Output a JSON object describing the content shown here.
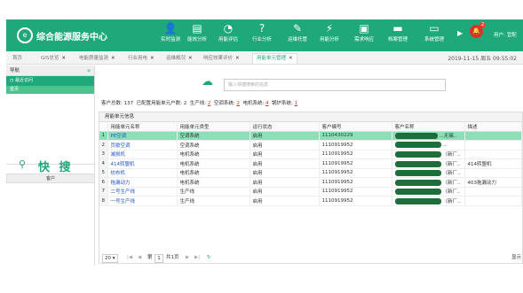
{
  "header": {
    "brand": "综合能源服务中心",
    "nav": [
      {
        "icon": "monitor-person-icon",
        "glyph": "👤",
        "label": "实时监测"
      },
      {
        "icon": "chart-window-icon",
        "glyph": "▤",
        "label": "能效分析"
      },
      {
        "icon": "gauge-icon",
        "glyph": "◔",
        "label": "用能评估"
      },
      {
        "icon": "question-icon",
        "glyph": "?",
        "label": "行业分析"
      },
      {
        "icon": "wrench-icon",
        "glyph": "✎",
        "label": "运维托管"
      },
      {
        "icon": "energy-analysis-icon",
        "glyph": "⚡",
        "label": "用能分析"
      },
      {
        "icon": "demand-response-icon",
        "glyph": "▣",
        "label": "需求响应"
      },
      {
        "icon": "archive-icon",
        "glyph": "▬",
        "label": "档案管理"
      },
      {
        "icon": "system-icon",
        "glyph": "▭",
        "label": "系统管理"
      }
    ],
    "notification_count": "2",
    "user_label": "用户: 宜配"
  },
  "tabs": [
    {
      "label": "首页",
      "closable": false
    },
    {
      "label": "GIS总览",
      "closable": true
    },
    {
      "label": "电能质量监测",
      "closable": true
    },
    {
      "label": "行业用电",
      "closable": true
    },
    {
      "label": "运维概况",
      "closable": true
    },
    {
      "label": "响应效果评价",
      "closable": true
    },
    {
      "label": "用能单元管理",
      "closable": true,
      "active": true
    }
  ],
  "datetime": "2019-11-15 周五 09:55:02",
  "sidebar": {
    "title": "导航",
    "recent_label": "最近访问",
    "selected_item": "首页",
    "quick_search": "快 搜",
    "customer_header": "客户"
  },
  "search": {
    "placeholder": "输入快捷搜索的信息"
  },
  "stats": {
    "total_label": "客户总数:",
    "total_value": "137",
    "configured_label": "已配置用能单元户数:",
    "configured_value": "2",
    "production_label": "生产线:",
    "production_value": "2",
    "aircon_label": "空调系统:",
    "aircon_value": "2",
    "motor_label": "电机系统:",
    "motor_value": "4",
    "boiler_label": "锅炉系统:",
    "boiler_value": "1"
  },
  "table": {
    "title": "用能单元信息",
    "columns": [
      "用能单元名称",
      "用能单元类型",
      "运行状态",
      "客户编号",
      "客户名称",
      "描述"
    ],
    "rows": [
      {
        "n": "1",
        "name": "PE空调",
        "type": "空调系统",
        "status": "启用",
        "cust_no": "1110430229",
        "cust_name": "...无锡..",
        "desc": ""
      },
      {
        "n": "2",
        "name": "页歇空调",
        "type": "空调系统",
        "status": "启用",
        "cust_no": "1110919952",
        "cust_name": "...",
        "desc": ""
      },
      {
        "n": "3",
        "name": "减损机",
        "type": "电机系统",
        "status": "启用",
        "cust_no": "1110919952",
        "cust_name": "（新厂..",
        "desc": ""
      },
      {
        "n": "4",
        "name": "414转盟机",
        "type": "电机系统",
        "status": "启用",
        "cust_no": "1110919952",
        "cust_name": "（新厂..",
        "desc": "414转盟机"
      },
      {
        "n": "5",
        "name": "纺布机",
        "type": "电机系统",
        "status": "启用",
        "cust_no": "1110919952",
        "cust_name": "（新厂..",
        "desc": ""
      },
      {
        "n": "6",
        "name": "拖漏动力",
        "type": "电机系统",
        "status": "启用",
        "cust_no": "1110919952",
        "cust_name": "（新厂..",
        "desc": "403拖漏动力"
      },
      {
        "n": "7",
        "name": "二号生产线",
        "type": "生产线",
        "status": "启用",
        "cust_no": "1110919952",
        "cust_name": "（新厂..",
        "desc": ""
      },
      {
        "n": "8",
        "name": "一号生产线",
        "type": "生产线",
        "status": "启用",
        "cust_no": "1110919952",
        "cust_name": "（新厂..",
        "desc": ""
      }
    ]
  },
  "pager": {
    "page_size": "20",
    "page_label_pre": "第",
    "page_value": "1",
    "page_label_post": "共1页",
    "right_text": "显示"
  },
  "colors": {
    "accent": "#1fa87a",
    "selected_row": "#8edfb8",
    "redacted": "#1d6e3a"
  }
}
